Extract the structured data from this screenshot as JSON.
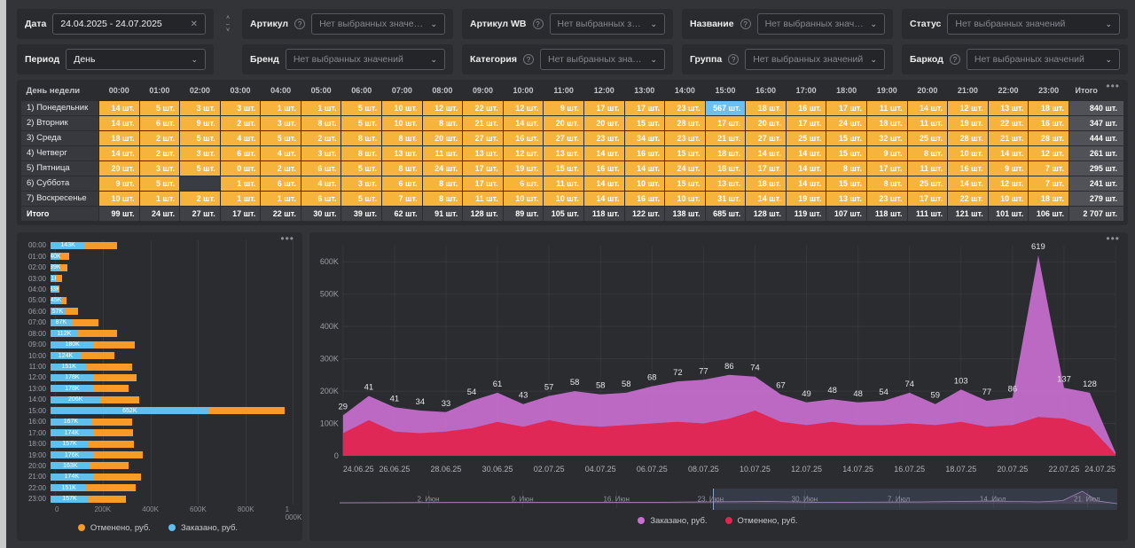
{
  "filters": {
    "placeholder": "Нет выбранных значений",
    "row1": [
      {
        "id": "date",
        "label": "Дата",
        "value": "24.04.2025 - 24.07.2025",
        "control": "date",
        "info": false
      },
      {
        "id": "article",
        "label": "Артикул",
        "control": "select",
        "info": true
      },
      {
        "id": "article-wb",
        "label": "Артикул WB",
        "control": "select",
        "info": true
      },
      {
        "id": "name",
        "label": "Название",
        "control": "select",
        "info": true
      },
      {
        "id": "status",
        "label": "Статус",
        "control": "select",
        "info": false
      }
    ],
    "row2": [
      {
        "id": "period",
        "label": "Период",
        "value": "День",
        "control": "select-value",
        "info": false
      },
      {
        "id": "brand",
        "label": "Бренд",
        "control": "select",
        "info": false
      },
      {
        "id": "category",
        "label": "Категория",
        "control": "select",
        "info": true
      },
      {
        "id": "group",
        "label": "Группа",
        "control": "select",
        "info": true
      },
      {
        "id": "barcode",
        "label": "Баркод",
        "control": "select",
        "info": true
      }
    ]
  },
  "heatmap": {
    "corner_label": "День недели",
    "hours": [
      "00:00",
      "01:00",
      "02:00",
      "03:00",
      "04:00",
      "05:00",
      "06:00",
      "07:00",
      "08:00",
      "09:00",
      "10:00",
      "11:00",
      "12:00",
      "13:00",
      "14:00",
      "15:00",
      "16:00",
      "17:00",
      "18:00",
      "19:00",
      "20:00",
      "21:00",
      "22:00",
      "23:00"
    ],
    "total_label": "Итого",
    "unit": "шт.",
    "rows": [
      {
        "label": "1) Понедельник",
        "values": [
          14,
          5,
          3,
          3,
          1,
          1,
          5,
          10,
          12,
          22,
          12,
          9,
          17,
          17,
          23,
          567,
          18,
          16,
          17,
          11,
          14,
          12,
          13,
          18
        ],
        "total": "840 шт."
      },
      {
        "label": "2) Вторник",
        "values": [
          14,
          6,
          9,
          2,
          3,
          8,
          5,
          10,
          8,
          21,
          14,
          20,
          20,
          15,
          28,
          17,
          20,
          17,
          24,
          18,
          11,
          19,
          22,
          16
        ],
        "total": "347 шт."
      },
      {
        "label": "3) Среда",
        "values": [
          18,
          2,
          5,
          4,
          5,
          2,
          8,
          8,
          20,
          27,
          16,
          27,
          23,
          34,
          23,
          21,
          27,
          25,
          15,
          32,
          25,
          28,
          21,
          28
        ],
        "total": "444 шт."
      },
      {
        "label": "4) Четверг",
        "values": [
          14,
          2,
          3,
          6,
          4,
          3,
          8,
          13,
          11,
          13,
          12,
          13,
          14,
          16,
          15,
          18,
          14,
          14,
          15,
          9,
          8,
          10,
          14,
          12
        ],
        "total": "261 шт."
      },
      {
        "label": "5) Пятница",
        "values": [
          20,
          3,
          5,
          0,
          2,
          6,
          5,
          8,
          24,
          17,
          19,
          15,
          16,
          14,
          24,
          18,
          17,
          14,
          8,
          17,
          11,
          16,
          9,
          7
        ],
        "total": "295 шт."
      },
      {
        "label": "6) Суббота",
        "values": [
          9,
          5,
          null,
          1,
          6,
          4,
          3,
          6,
          8,
          17,
          6,
          11,
          14,
          10,
          15,
          13,
          18,
          14,
          15,
          8,
          25,
          14,
          12,
          7
        ],
        "total": "241 шт."
      },
      {
        "label": "7) Воскресенье",
        "values": [
          10,
          1,
          2,
          1,
          1,
          6,
          5,
          7,
          8,
          11,
          10,
          10,
          14,
          16,
          10,
          31,
          14,
          19,
          13,
          23,
          17,
          22,
          10,
          18
        ],
        "total": "279 шт."
      }
    ],
    "totals": {
      "label": "Итого",
      "values": [
        "99 шт.",
        "24 шт.",
        "27 шт.",
        "17 шт.",
        "22 шт.",
        "30 шт.",
        "39 шт.",
        "62 шт.",
        "91 шт.",
        "128 шт.",
        "89 шт.",
        "105 шт.",
        "118 шт.",
        "122 шт.",
        "138 шт.",
        "685 шт.",
        "128 шт.",
        "119 шт.",
        "107 шт.",
        "118 шт.",
        "111 шт.",
        "121 шт.",
        "101 шт.",
        "106 шт."
      ],
      "grand": "2 707 шт."
    },
    "highlight_cell": {
      "row": 0,
      "col": 15
    },
    "empty_cell": {
      "row": 5,
      "col": 2
    },
    "colors": {
      "cell": "#f6b43c",
      "highlight": "#6cc0ef",
      "empty": "#3a3c44"
    }
  },
  "chart_data": [
    {
      "type": "bar",
      "orientation": "horizontal",
      "stacked": true,
      "categories": [
        "00:00",
        "01:00",
        "02:00",
        "03:00",
        "04:00",
        "05:00",
        "06:00",
        "07:00",
        "08:00",
        "09:00",
        "10:00",
        "11:00",
        "12:00",
        "13:00",
        "14:00",
        "15:00",
        "16:00",
        "17:00",
        "18:00",
        "19:00",
        "20:00",
        "21:00",
        "22:00",
        "23:00"
      ],
      "series": [
        {
          "name": "Заказано, руб.",
          "color": "#5fc0ee",
          "values_k": [
            143,
            40,
            39,
            21,
            33,
            45,
            57,
            87,
            112,
            180,
            124,
            151,
            178,
            178,
            206,
            652,
            167,
            174,
            157,
            176,
            163,
            174,
            151,
            157
          ]
        },
        {
          "name": "Отменено, руб.",
          "color": "#f79a28",
          "values_k": [
            130,
            38,
            30,
            25,
            4,
            21,
            56,
            110,
            160,
            165,
            140,
            185,
            175,
            145,
            160,
            310,
            170,
            165,
            185,
            205,
            160,
            200,
            200,
            155
          ]
        }
      ],
      "xlim_k": [
        0,
        1000
      ],
      "x_ticks": [
        "0",
        "200K",
        "400K",
        "600K",
        "800K",
        "1 000K"
      ],
      "legend": [
        {
          "label": "Отменено, руб.",
          "color": "#f79a28"
        },
        {
          "label": "Заказано, руб.",
          "color": "#5fc0ee"
        }
      ]
    },
    {
      "type": "area",
      "x_ticks": [
        "24.06.25",
        "26.06.25",
        "28.06.25",
        "30.06.25",
        "02.07.25",
        "04.07.25",
        "06.07.25",
        "08.07.25",
        "10.07.25",
        "12.07.25",
        "14.07.25",
        "16.07.25",
        "18.07.25",
        "20.07.25",
        "22.07.25",
        "24.07.25"
      ],
      "y_ticks": [
        "0",
        "100K",
        "200K",
        "300K",
        "400K",
        "500K",
        "600K"
      ],
      "ylim_k": [
        0,
        650
      ],
      "series": [
        {
          "name": "Заказано, руб.",
          "color": "#c96fd0",
          "values_k": [
            125,
            185,
            150,
            140,
            135,
            170,
            195,
            160,
            185,
            200,
            190,
            195,
            215,
            230,
            235,
            250,
            245,
            190,
            165,
            175,
            165,
            170,
            195,
            160,
            205,
            170,
            180,
            620,
            210,
            195,
            10
          ],
          "point_labels": [
            29,
            41,
            41,
            34,
            33,
            54,
            61,
            43,
            57,
            58,
            58,
            58,
            68,
            72,
            77,
            86,
            74,
            67,
            49,
            48,
            48,
            54,
            74,
            59,
            103,
            77,
            86,
            619,
            137,
            128,
            null
          ]
        },
        {
          "name": "Отменено, руб.",
          "color": "#e02550",
          "values_k": [
            70,
            110,
            75,
            70,
            75,
            85,
            105,
            90,
            110,
            95,
            90,
            95,
            100,
            105,
            100,
            115,
            140,
            105,
            95,
            105,
            95,
            95,
            100,
            95,
            105,
            90,
            95,
            120,
            115,
            90,
            5
          ]
        }
      ],
      "legend": [
        {
          "label": "Заказано, руб.",
          "color": "#c96fd0"
        },
        {
          "label": "Отменено, руб.",
          "color": "#e02550"
        }
      ],
      "navigator": {
        "ticks": [
          "2. Июн",
          "9. Июн",
          "16. Июн",
          "23. Июн",
          "30. Июн",
          "7. Июл",
          "14. Июл",
          "21. Июл"
        ],
        "selection_start_pct": 48
      }
    }
  ],
  "icons": {
    "more": "•••",
    "clear": "✕",
    "chevron": "⌄",
    "info": "?",
    "step_up": "˄",
    "step_down": "˅",
    "step_mid": "‒"
  }
}
